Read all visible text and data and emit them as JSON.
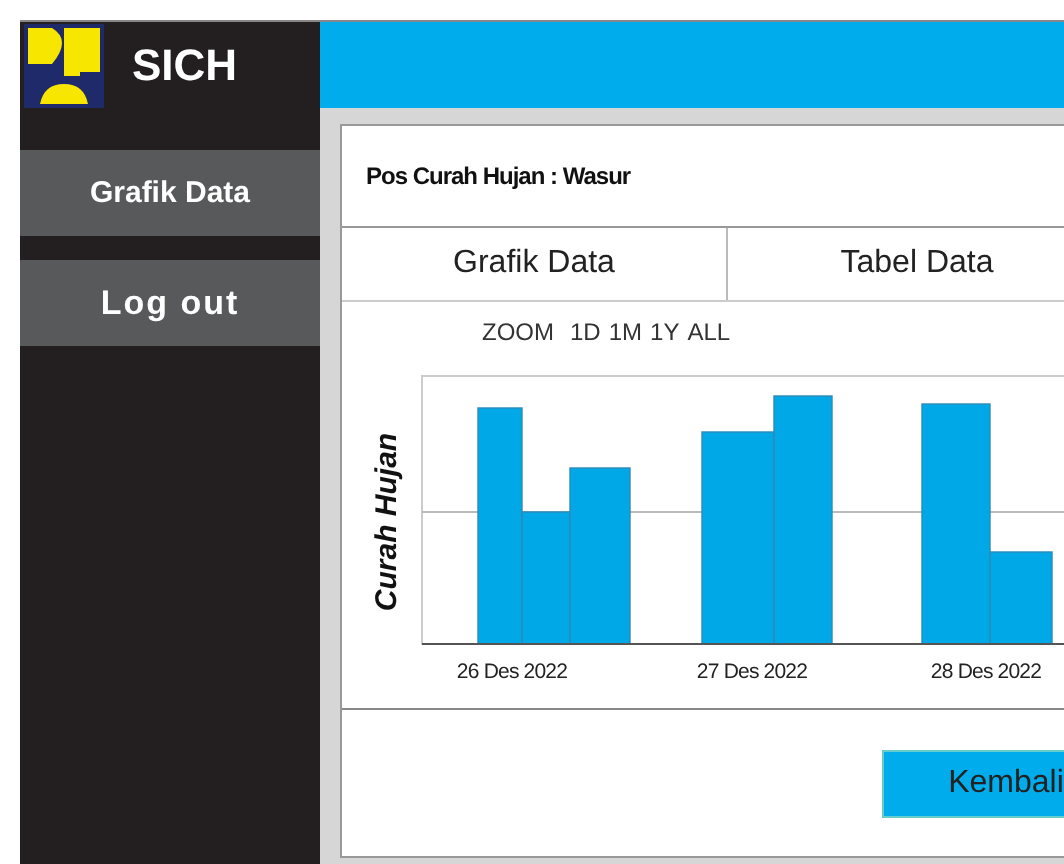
{
  "brand": "SICH",
  "sidebar": {
    "items": [
      {
        "label": "Grafik Data"
      },
      {
        "label": "Log out"
      }
    ]
  },
  "panel": {
    "title": "Pos Curah Hujan : Wasur",
    "tabs": [
      {
        "label": "Grafik Data"
      },
      {
        "label": "Tabel Data"
      }
    ],
    "chart": {
      "zoom_label": "ZOOM",
      "ranges": [
        "1D",
        "1M",
        "1Y",
        "ALL"
      ],
      "ylabel": "Curah Hujan",
      "x_labels": [
        "26 Des 2022",
        "27 Des 2022",
        "28 Des 2022"
      ]
    },
    "button": "Kembali"
  }
}
